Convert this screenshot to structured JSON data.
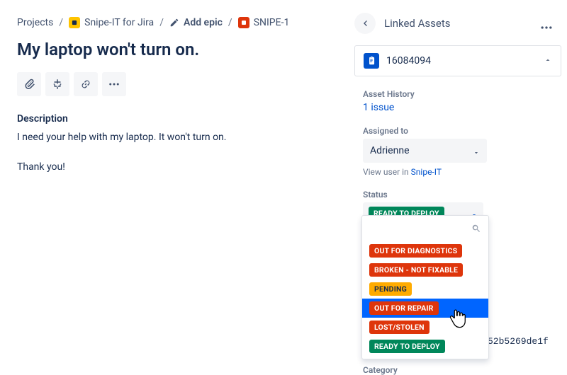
{
  "breadcrumb": {
    "projects": "Projects",
    "app": "Snipe-IT for Jira",
    "add_epic": "Add epic",
    "issue_key": "SNIPE-1"
  },
  "issue": {
    "title": "My laptop won't turn on.",
    "description_label": "Description",
    "description_body": "I need your help with my laptop. It won't turn on.\n\nThank you!"
  },
  "side": {
    "linked_assets": "Linked Assets",
    "asset_tag": "16084094",
    "asset_history_label": "Asset History",
    "issue_count": "1 issue",
    "assigned_to_label": "Assigned to",
    "assignee": "Adrienne",
    "view_user_hint_prefix": "View user in ",
    "view_user_hint_link": "Snipe-IT",
    "status_label": "Status",
    "status_selected": "READY TO DEPLOY",
    "category_label": "Category"
  },
  "status_options": [
    {
      "label": "OUT FOR DIAGNOSTICS",
      "color": "b-red"
    },
    {
      "label": "BROKEN - NOT FIXABLE",
      "color": "b-red"
    },
    {
      "label": "PENDING",
      "color": "b-yellow"
    },
    {
      "label": "OUT FOR REPAIR",
      "color": "b-red",
      "hover": true
    },
    {
      "label": "LOST/STOLEN",
      "color": "b-red"
    },
    {
      "label": "READY TO DEPLOY",
      "color": "b-green"
    }
  ],
  "trailing": "52b5269de1f"
}
